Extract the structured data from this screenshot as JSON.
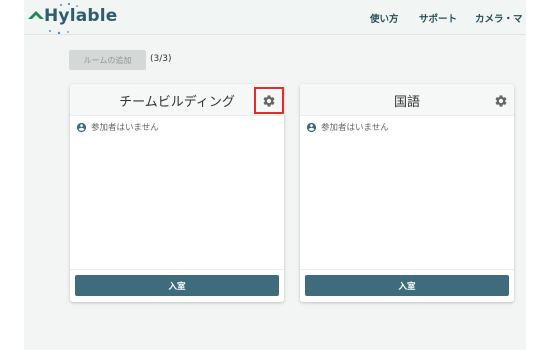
{
  "header": {
    "logo_text": "Hylable",
    "nav": [
      "使い方",
      "サポート",
      "カメラ・マ"
    ]
  },
  "toolbar": {
    "add_room_label": "ルームの追加",
    "room_count": "(3/3)"
  },
  "rooms": [
    {
      "title": "チームビルディング",
      "participants_text": "参加者はいません",
      "enter_label": "入室",
      "settings_highlighted": true
    },
    {
      "title": "国語",
      "participants_text": "参加者はいません",
      "enter_label": "入室",
      "settings_highlighted": false
    }
  ],
  "colors": {
    "brand": "#2e5d6e",
    "logo_green": "#1e8a5a",
    "enter_button": "#3e6c7c",
    "highlight": "#e32c2c"
  },
  "icons": [
    "hylable-logo-icon",
    "gear-icon",
    "account-circle-icon"
  ]
}
